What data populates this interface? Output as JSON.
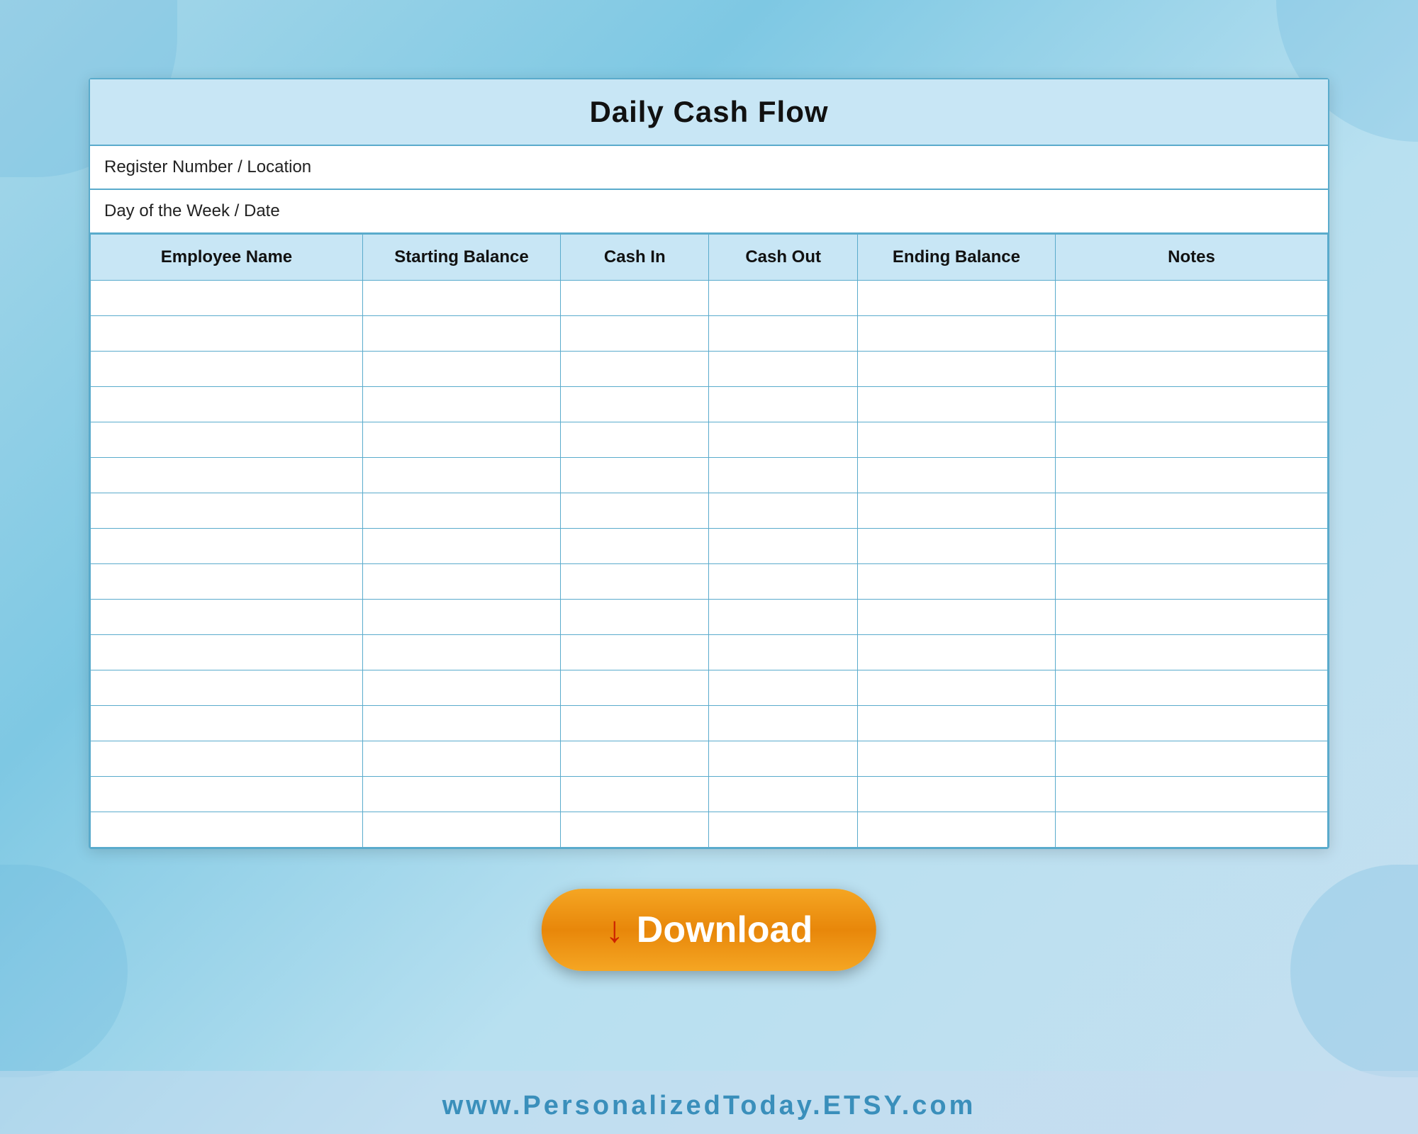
{
  "page": {
    "background_color": "#7ec8e3",
    "watermark_text": "PersonalizedToday"
  },
  "card": {
    "title": "Daily Cash Flow",
    "register_row": {
      "label": "Register Number / Location"
    },
    "day_row": {
      "label": "Day of the Week / Date"
    },
    "table": {
      "headers": [
        "Employee Name",
        "Starting Balance",
        "Cash In",
        "Cash Out",
        "Ending Balance",
        "Notes"
      ],
      "row_count": 16
    }
  },
  "download_button": {
    "label": "Download",
    "arrow": "↓"
  },
  "footer": {
    "text": "www.PersonalizedToday.ETSY.com"
  }
}
